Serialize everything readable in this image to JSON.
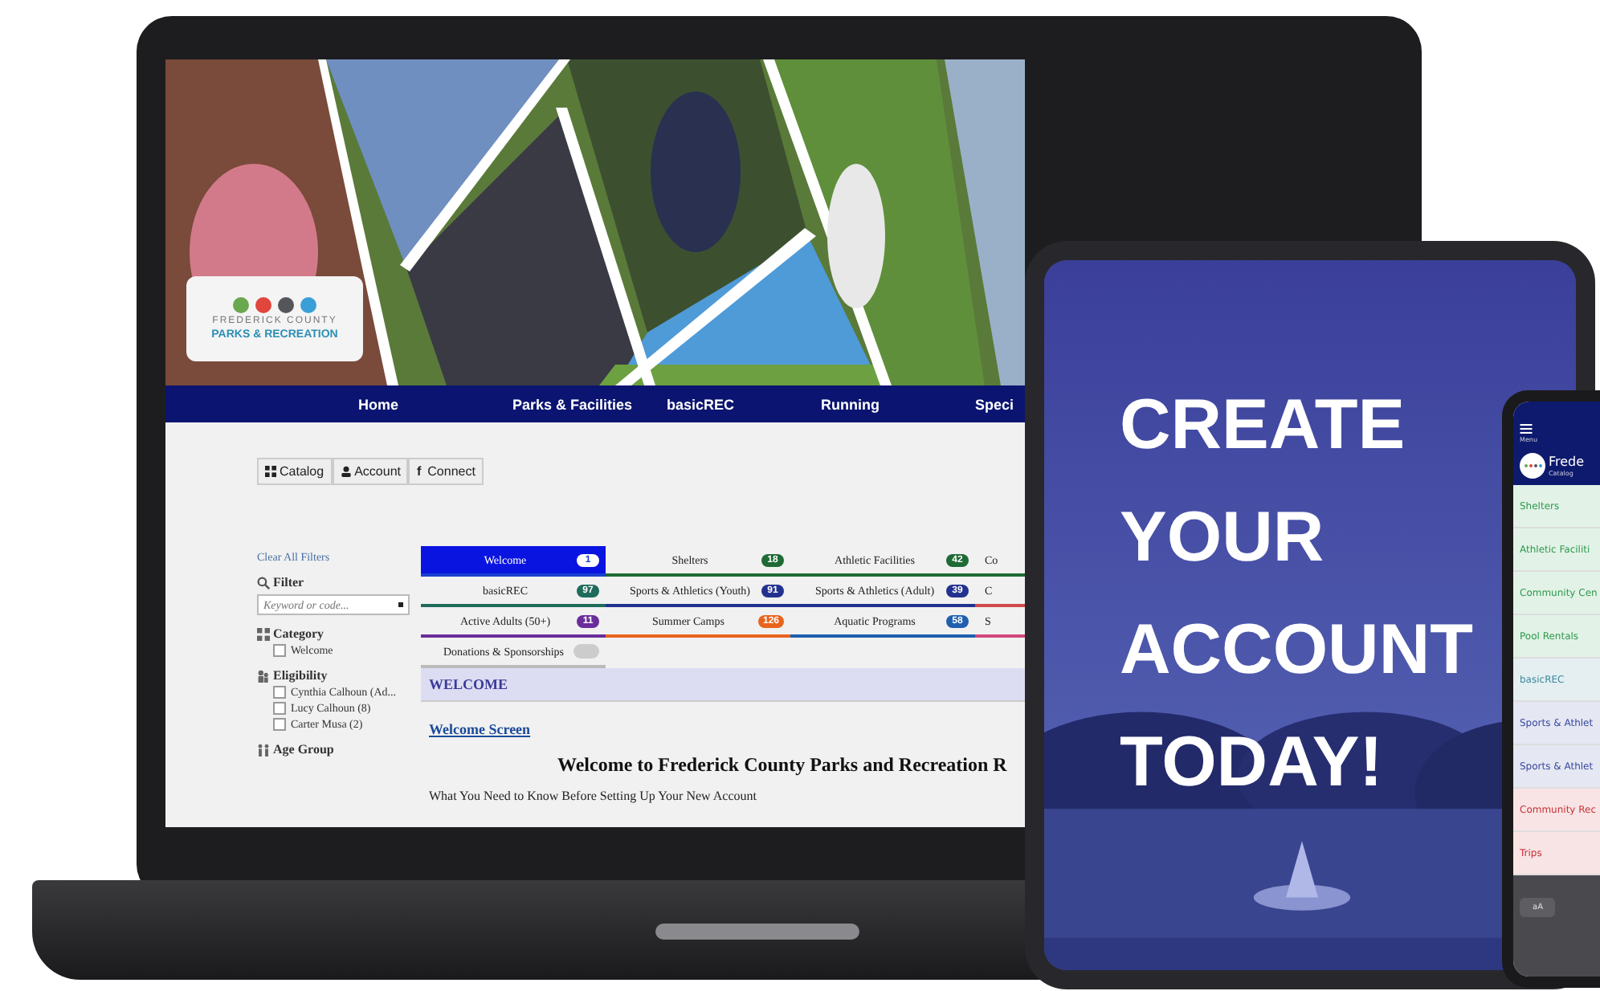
{
  "laptop": {
    "logo": {
      "dots": [
        {
          "color": "#6aa84f"
        },
        {
          "color": "#e0463c"
        },
        {
          "color": "#55565a"
        },
        {
          "color": "#3a9fd6"
        }
      ],
      "line1": "FREDERICK COUNTY",
      "line2": "PARKS & RECREATION"
    },
    "nav": [
      "Home",
      "Parks & Facilities",
      "basicREC",
      "Running",
      "Speci"
    ],
    "buttons": [
      {
        "kind": "grid",
        "label": "Catalog"
      },
      {
        "kind": "person",
        "label": "Account"
      },
      {
        "kind": "char",
        "icon": "f",
        "label": "Connect"
      }
    ],
    "sidebar": {
      "clear": "Clear All Filters",
      "filter_title": "Filter",
      "search": {
        "placeholder": "Keyword or code..."
      },
      "groups": [
        {
          "kind": "grid",
          "title": "Category",
          "options": [
            {
              "label": "Welcome",
              "checked": false
            }
          ]
        },
        {
          "kind": "people",
          "title": "Eligibility",
          "options": [
            {
              "label": "Cynthia Calhoun (Ad...",
              "checked": false
            },
            {
              "label": "Lucy Calhoun (8)",
              "checked": false
            },
            {
              "label": "Carter Musa (2)",
              "checked": false
            }
          ]
        },
        {
          "kind": "age",
          "title": "Age Group"
        }
      ]
    },
    "tabs": [
      {
        "label": "Welcome",
        "count": "1",
        "color": "#1a3fd0",
        "selected": true
      },
      {
        "label": "Shelters",
        "count": "18",
        "color": "#1e6b35",
        "selected": false
      },
      {
        "label": "Athletic Facilities",
        "count": "42",
        "color": "#1e6b35",
        "selected": false
      },
      {
        "label": "Co",
        "color": "#1e6b35",
        "selected": false
      },
      {
        "label": "basicREC",
        "count": "97",
        "color": "#1f6b5c",
        "selected": false
      },
      {
        "label": "Sports & Athletics (Youth)",
        "count": "91",
        "color": "#23318f",
        "selected": false
      },
      {
        "label": "Sports & Athletics (Adult)",
        "count": "39",
        "color": "#23318f",
        "selected": false
      },
      {
        "label": "C",
        "color": "#d04a4a",
        "selected": false
      },
      {
        "label": "Active Adults (50+)",
        "count": "11",
        "color": "#6a2d9a",
        "selected": false
      },
      {
        "label": "Summer Camps",
        "count": "126",
        "color": "#e8641e",
        "selected": false
      },
      {
        "label": "Aquatic Programs",
        "count": "58",
        "color": "#1f5fae",
        "selected": false
      },
      {
        "label": "S",
        "color": "#d0487a",
        "selected": false
      },
      {
        "label": "Donations & Sponsorships",
        "color": "#bbbbbb",
        "selected": false,
        "disabled": true
      }
    ],
    "section": "WELCOME",
    "link": "Welcome Screen",
    "heading": "Welcome to Frederick County Parks and Recreation R",
    "text": "What You Need to Know Before Setting Up Your New Account"
  },
  "tablet": {
    "lines": [
      "CREATE",
      "YOUR",
      "ACCOUNT",
      "TODAY!"
    ]
  },
  "phone": {
    "menu": "Menu",
    "title": "Frede",
    "subtitle": "Catalog",
    "items": [
      {
        "label": "Shelters",
        "color": "#2e9a4e"
      },
      {
        "label": "Athletic Faciliti",
        "color": "#2e9a4e"
      },
      {
        "label": "Community Cen",
        "color": "#2e9a4e"
      },
      {
        "label": "Pool Rentals",
        "color": "#2e9a4e"
      },
      {
        "label": "basicREC",
        "color": "#3a8a9a"
      },
      {
        "label": "Sports & Athlet",
        "color": "#3a4aa0"
      },
      {
        "label": "Sports & Athlet",
        "color": "#3a4aa0"
      },
      {
        "label": "Community Rec",
        "color": "#c8323a"
      },
      {
        "label": "Trips",
        "color": "#c8323a"
      }
    ],
    "bar": "aA"
  }
}
